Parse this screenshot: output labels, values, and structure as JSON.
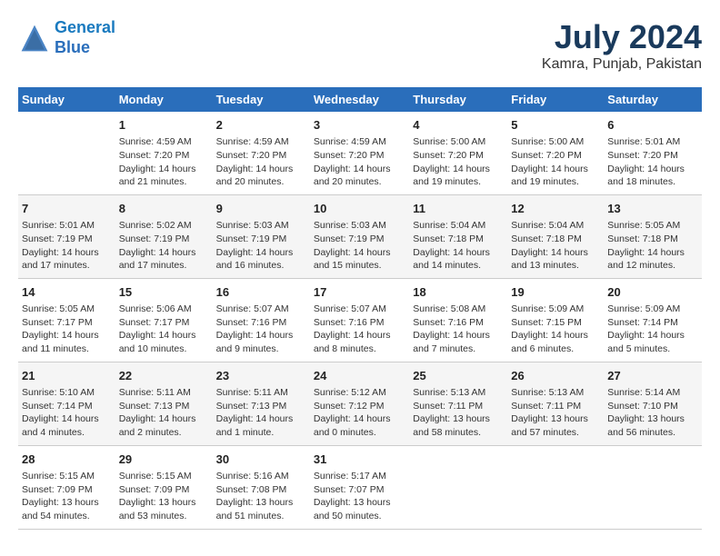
{
  "header": {
    "logo_line1": "General",
    "logo_line2": "Blue",
    "month": "July 2024",
    "location": "Kamra, Punjab, Pakistan"
  },
  "days_of_week": [
    "Sunday",
    "Monday",
    "Tuesday",
    "Wednesday",
    "Thursday",
    "Friday",
    "Saturday"
  ],
  "weeks": [
    [
      {
        "day": "",
        "detail": ""
      },
      {
        "day": "1",
        "detail": "Sunrise: 4:59 AM\nSunset: 7:20 PM\nDaylight: 14 hours and 21 minutes."
      },
      {
        "day": "2",
        "detail": "Sunrise: 4:59 AM\nSunset: 7:20 PM\nDaylight: 14 hours and 20 minutes."
      },
      {
        "day": "3",
        "detail": "Sunrise: 4:59 AM\nSunset: 7:20 PM\nDaylight: 14 hours and 20 minutes."
      },
      {
        "day": "4",
        "detail": "Sunrise: 5:00 AM\nSunset: 7:20 PM\nDaylight: 14 hours and 19 minutes."
      },
      {
        "day": "5",
        "detail": "Sunrise: 5:00 AM\nSunset: 7:20 PM\nDaylight: 14 hours and 19 minutes."
      },
      {
        "day": "6",
        "detail": "Sunrise: 5:01 AM\nSunset: 7:20 PM\nDaylight: 14 hours and 18 minutes."
      }
    ],
    [
      {
        "day": "7",
        "detail": "Sunrise: 5:01 AM\nSunset: 7:19 PM\nDaylight: 14 hours and 17 minutes."
      },
      {
        "day": "8",
        "detail": "Sunrise: 5:02 AM\nSunset: 7:19 PM\nDaylight: 14 hours and 17 minutes."
      },
      {
        "day": "9",
        "detail": "Sunrise: 5:03 AM\nSunset: 7:19 PM\nDaylight: 14 hours and 16 minutes."
      },
      {
        "day": "10",
        "detail": "Sunrise: 5:03 AM\nSunset: 7:19 PM\nDaylight: 14 hours and 15 minutes."
      },
      {
        "day": "11",
        "detail": "Sunrise: 5:04 AM\nSunset: 7:18 PM\nDaylight: 14 hours and 14 minutes."
      },
      {
        "day": "12",
        "detail": "Sunrise: 5:04 AM\nSunset: 7:18 PM\nDaylight: 14 hours and 13 minutes."
      },
      {
        "day": "13",
        "detail": "Sunrise: 5:05 AM\nSunset: 7:18 PM\nDaylight: 14 hours and 12 minutes."
      }
    ],
    [
      {
        "day": "14",
        "detail": "Sunrise: 5:05 AM\nSunset: 7:17 PM\nDaylight: 14 hours and 11 minutes."
      },
      {
        "day": "15",
        "detail": "Sunrise: 5:06 AM\nSunset: 7:17 PM\nDaylight: 14 hours and 10 minutes."
      },
      {
        "day": "16",
        "detail": "Sunrise: 5:07 AM\nSunset: 7:16 PM\nDaylight: 14 hours and 9 minutes."
      },
      {
        "day": "17",
        "detail": "Sunrise: 5:07 AM\nSunset: 7:16 PM\nDaylight: 14 hours and 8 minutes."
      },
      {
        "day": "18",
        "detail": "Sunrise: 5:08 AM\nSunset: 7:16 PM\nDaylight: 14 hours and 7 minutes."
      },
      {
        "day": "19",
        "detail": "Sunrise: 5:09 AM\nSunset: 7:15 PM\nDaylight: 14 hours and 6 minutes."
      },
      {
        "day": "20",
        "detail": "Sunrise: 5:09 AM\nSunset: 7:14 PM\nDaylight: 14 hours and 5 minutes."
      }
    ],
    [
      {
        "day": "21",
        "detail": "Sunrise: 5:10 AM\nSunset: 7:14 PM\nDaylight: 14 hours and 4 minutes."
      },
      {
        "day": "22",
        "detail": "Sunrise: 5:11 AM\nSunset: 7:13 PM\nDaylight: 14 hours and 2 minutes."
      },
      {
        "day": "23",
        "detail": "Sunrise: 5:11 AM\nSunset: 7:13 PM\nDaylight: 14 hours and 1 minute."
      },
      {
        "day": "24",
        "detail": "Sunrise: 5:12 AM\nSunset: 7:12 PM\nDaylight: 14 hours and 0 minutes."
      },
      {
        "day": "25",
        "detail": "Sunrise: 5:13 AM\nSunset: 7:11 PM\nDaylight: 13 hours and 58 minutes."
      },
      {
        "day": "26",
        "detail": "Sunrise: 5:13 AM\nSunset: 7:11 PM\nDaylight: 13 hours and 57 minutes."
      },
      {
        "day": "27",
        "detail": "Sunrise: 5:14 AM\nSunset: 7:10 PM\nDaylight: 13 hours and 56 minutes."
      }
    ],
    [
      {
        "day": "28",
        "detail": "Sunrise: 5:15 AM\nSunset: 7:09 PM\nDaylight: 13 hours and 54 minutes."
      },
      {
        "day": "29",
        "detail": "Sunrise: 5:15 AM\nSunset: 7:09 PM\nDaylight: 13 hours and 53 minutes."
      },
      {
        "day": "30",
        "detail": "Sunrise: 5:16 AM\nSunset: 7:08 PM\nDaylight: 13 hours and 51 minutes."
      },
      {
        "day": "31",
        "detail": "Sunrise: 5:17 AM\nSunset: 7:07 PM\nDaylight: 13 hours and 50 minutes."
      },
      {
        "day": "",
        "detail": ""
      },
      {
        "day": "",
        "detail": ""
      },
      {
        "day": "",
        "detail": ""
      }
    ]
  ]
}
